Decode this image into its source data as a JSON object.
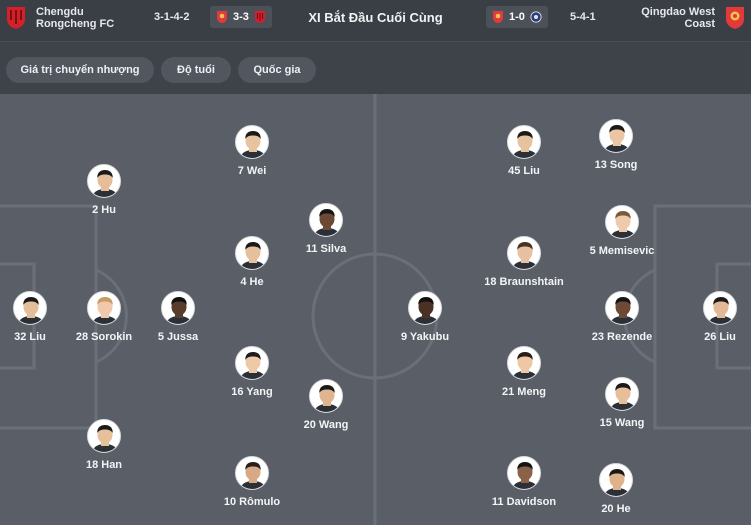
{
  "header": {
    "title": "XI Bắt Đầu Cuối Cùng",
    "home": {
      "name_line1": "Chengdu",
      "name_line2": "Rongcheng FC",
      "formation": "3-1-4-2",
      "head_to_head": "3-3"
    },
    "away": {
      "name_line1": "Qingdao West",
      "name_line2": "Coast",
      "formation": "5-4-1",
      "head_to_head": "1-0"
    }
  },
  "filters": [
    "Giá trị chuyển nhượng",
    "Độ tuổi",
    "Quốc gia"
  ],
  "home_players": [
    {
      "label": "7 Wei",
      "skin": "#e8c3a0",
      "hair": "#1b1b1b"
    },
    {
      "label": "2 Hu",
      "skin": "#e5bd98",
      "hair": "#1b1b1b"
    },
    {
      "label": "11 Silva",
      "skin": "#6b4a35",
      "hair": "#151515"
    },
    {
      "label": "4 He",
      "skin": "#e6c09c",
      "hair": "#1a1a1a"
    },
    {
      "label": "32 Liu",
      "skin": "#e4bd99",
      "hair": "#1a1a1a"
    },
    {
      "label": "28 Sorokin",
      "skin": "#f0c9ad",
      "hair": "#c89a66"
    },
    {
      "label": "5 Jussa",
      "skin": "#5a3c2c",
      "hair": "#111111"
    },
    {
      "label": "16 Yang",
      "skin": "#edc9a8",
      "hair": "#1d1d1d"
    },
    {
      "label": "20 Wang",
      "skin": "#dfb48e",
      "hair": "#1a1a1a"
    },
    {
      "label": "18 Han",
      "skin": "#e6bf9b",
      "hair": "#1a1a1a"
    },
    {
      "label": "10 Rômulo",
      "skin": "#d7a985",
      "hair": "#2a2019"
    }
  ],
  "away_players": [
    {
      "label": "45 Liu",
      "skin": "#e7c29e",
      "hair": "#1a1a1a"
    },
    {
      "label": "13 Song",
      "skin": "#ecc6a4",
      "hair": "#1b1b1b"
    },
    {
      "label": "5 Memisevic",
      "skin": "#efc9ac",
      "hair": "#7a5a3c"
    },
    {
      "label": "18 Braunshtain",
      "skin": "#e8c0a0",
      "hair": "#4a3324"
    },
    {
      "label": "9 Yakubu",
      "skin": "#4b3123",
      "hair": "#111111"
    },
    {
      "label": "23 Rezende",
      "skin": "#6e4a34",
      "hair": "#151515"
    },
    {
      "label": "26 Liu",
      "skin": "#e2b994",
      "hair": "#1a1a1a"
    },
    {
      "label": "21 Meng",
      "skin": "#edc7a6",
      "hair": "#2a1e16"
    },
    {
      "label": "15 Wang",
      "skin": "#e6be9a",
      "hair": "#1a1a1a"
    },
    {
      "label": "11 Davidson",
      "skin": "#8a6248",
      "hair": "#151515"
    },
    {
      "label": "20 He",
      "skin": "#dfb28c",
      "hair": "#1a1a1a"
    }
  ],
  "colors": {
    "background": "#3e4249",
    "pitch": "#5a5f67",
    "pitch_lines": "#6b7078",
    "home_crest": "#d4202a",
    "away_crest": "#e23a3a",
    "away_opponent_badge": "#2c3e7a"
  }
}
